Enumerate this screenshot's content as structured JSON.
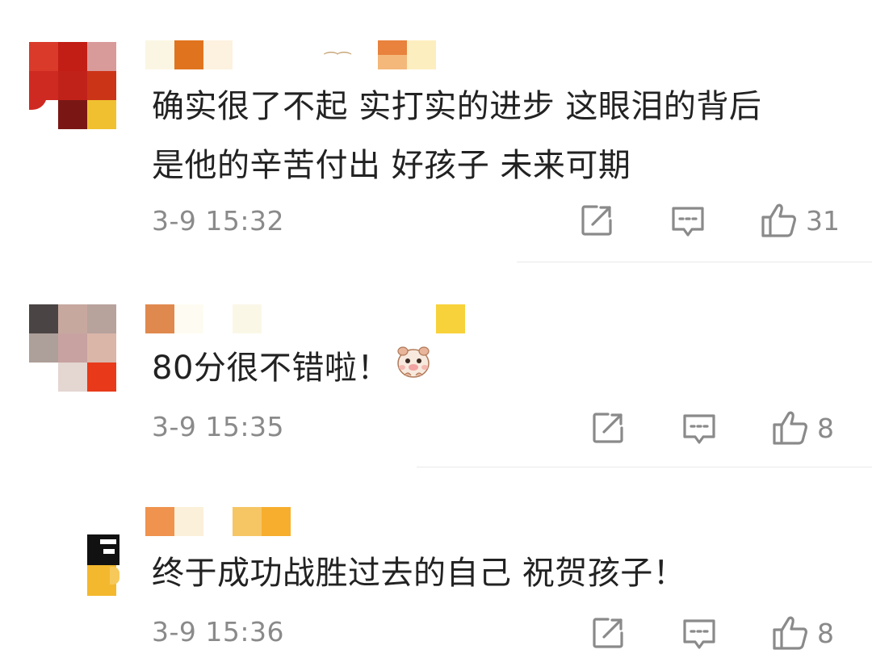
{
  "comments": [
    {
      "text": "确实很了不起 实打实的进步 这眼泪的背后是他的辛苦付出 好孩子 未来可期",
      "text_line1": "确实很了不起 实打实的进步 这眼泪的背后",
      "text_line2": "是他的辛苦付出 好孩子 未来可期",
      "time": "3-9 15:32",
      "likes": "31",
      "icons": [
        "share-icon",
        "reply-icon",
        "like-icon"
      ]
    },
    {
      "text": "80分很不错啦！",
      "emoji": "hamster-emoji-icon",
      "time": "3-9 15:35",
      "likes": "8",
      "icons": [
        "share-icon",
        "reply-icon",
        "like-icon"
      ]
    },
    {
      "text": "终于成功战胜过去的自己 祝贺孩子！",
      "time": "3-9 15:36",
      "likes": "8",
      "icons": [
        "share-icon",
        "reply-icon",
        "like-icon"
      ]
    }
  ],
  "colors": {
    "text": "#222222",
    "meta": "#8a8a8a",
    "divider": "#e9e9e9"
  }
}
